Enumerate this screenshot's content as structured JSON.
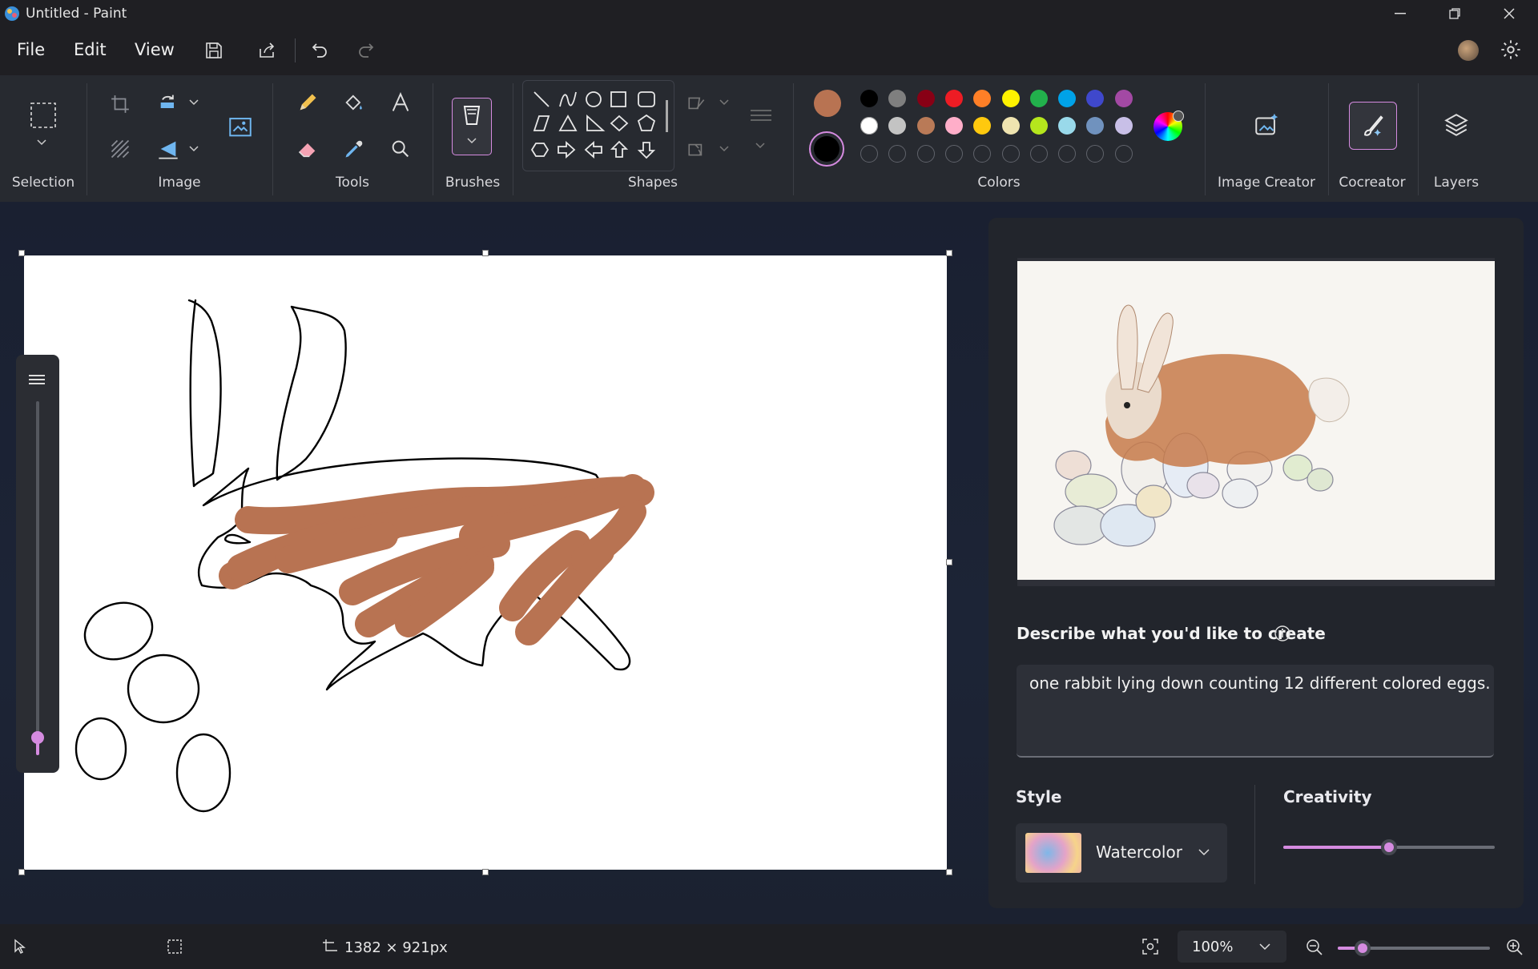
{
  "window": {
    "title": "Untitled - Paint"
  },
  "menu": {
    "file": "File",
    "edit": "Edit",
    "view": "View"
  },
  "ribbon": {
    "groups": {
      "selection": "Selection",
      "image": "Image",
      "tools": "Tools",
      "brushes": "Brushes",
      "shapes": "Shapes",
      "colors": "Colors",
      "image_creator": "Image Creator",
      "cocreator": "Cocreator",
      "layers": "Layers"
    },
    "colors": {
      "primary": "#b87352",
      "secondary": "#000000",
      "row1": [
        "#000000",
        "#7f7f7f",
        "#880015",
        "#ed1c24",
        "#ff7f27",
        "#fff200",
        "#22b14c",
        "#00a2e8",
        "#3f48cc",
        "#a349a4"
      ],
      "row2": [
        "#ffffff",
        "#c3c3c3",
        "#b97a57",
        "#ffaec9",
        "#ffc90e",
        "#efe4b0",
        "#b5e61d",
        "#99d9ea",
        "#7092be",
        "#c8bfe7"
      ]
    }
  },
  "cocreator": {
    "prompt_label": "Describe what you'd like to create",
    "prompt_value": "one rabbit lying down counting 12 different colored eggs.",
    "style_label": "Style",
    "style_value": "Watercolor",
    "creativity_label": "Creativity",
    "creativity_level": 0.5
  },
  "status": {
    "canvas_size": "1382 × 921px",
    "zoom": "100%"
  },
  "accent": "#d58be0"
}
